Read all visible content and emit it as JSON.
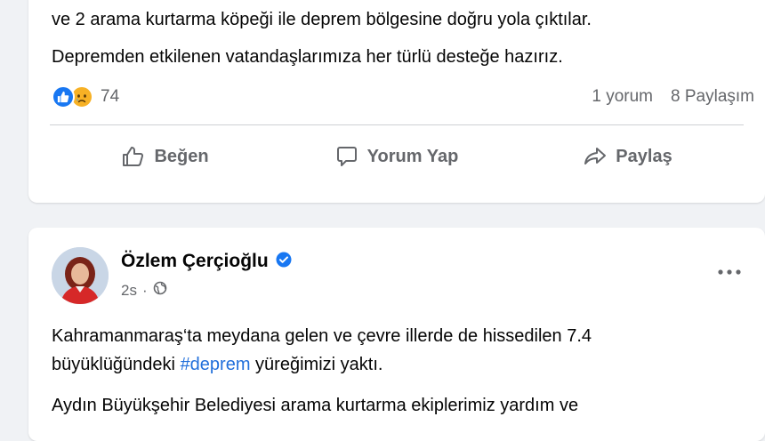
{
  "post1": {
    "text_line1": "ve 2 arama kurtarma köpeği ile deprem bölgesine doğru yola çıktılar.",
    "text_line2": "Depremden etkilenen vatandaşlarımıza her türlü desteğe hazırız.",
    "reaction_count": "74",
    "comments": "1 yorum",
    "shares": "8 Paylaşım",
    "reaction_icons": [
      "like-icon",
      "sad-icon"
    ],
    "actions": {
      "like": "Beğen",
      "comment": "Yorum Yap",
      "share": "Paylaş"
    }
  },
  "post2": {
    "author": "Özlem Çerçioğlu",
    "verified_icon": "verified-badge-icon",
    "time": "2s",
    "separator": "·",
    "audience_icon": "globe-icon",
    "text_line1": "Kahramanmaraş‘ta meydana gelen ve çevre illerde de hissedilen 7.4",
    "text_line2_before": "büyüklüğündeki ",
    "hashtag": "#deprem",
    "text_line2_after": " yüreğimizi yaktı.",
    "text_line3": "Aydın Büyükşehir Belediyesi arama kurtarma ekiplerimiz yardım ve"
  },
  "colors": {
    "background": "#f0f2f5",
    "card": "#ffffff",
    "secondary_text": "#65676b",
    "link": "#216fdb",
    "brand_blue": "#1877f2"
  }
}
